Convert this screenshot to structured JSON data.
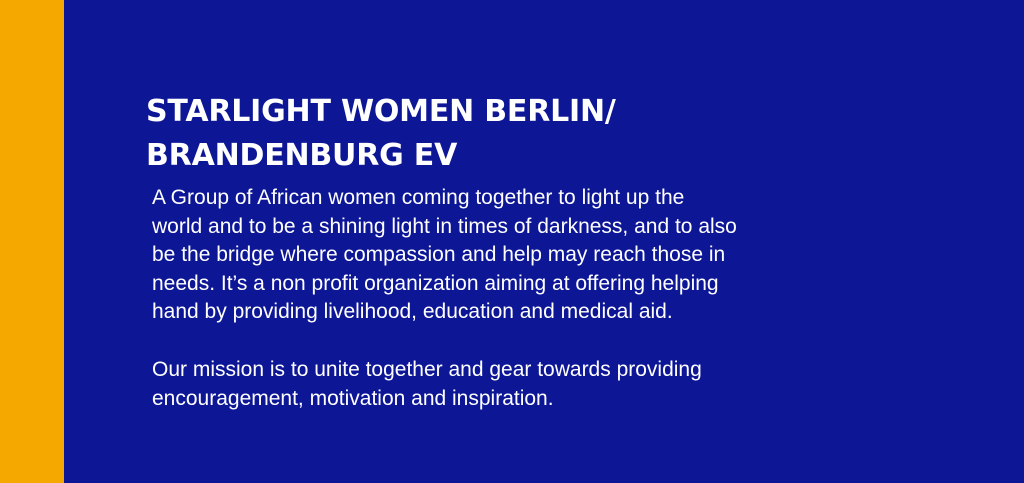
{
  "colors": {
    "background": "#0d1796",
    "accent_bar": "#f5a800",
    "text": "#ffffff"
  },
  "heading": {
    "lines": [
      "STARLIGHT WOMEN BERLIN/",
      "BRANDENBURG EV"
    ]
  },
  "intro": {
    "lines": [
      "A Group of African women coming together to light up the",
      "world and to be a shining light in times of darkness, and to also",
      "be the bridge where compassion and help may reach those in",
      "needs. It’s a non profit organization aiming at offering helping",
      "hand by providing livelihood, education and medical aid."
    ]
  },
  "mission": {
    "lines": [
      "Our mission is to unite together and gear towards providing",
      "encouragement, motivation and inspiration."
    ]
  }
}
